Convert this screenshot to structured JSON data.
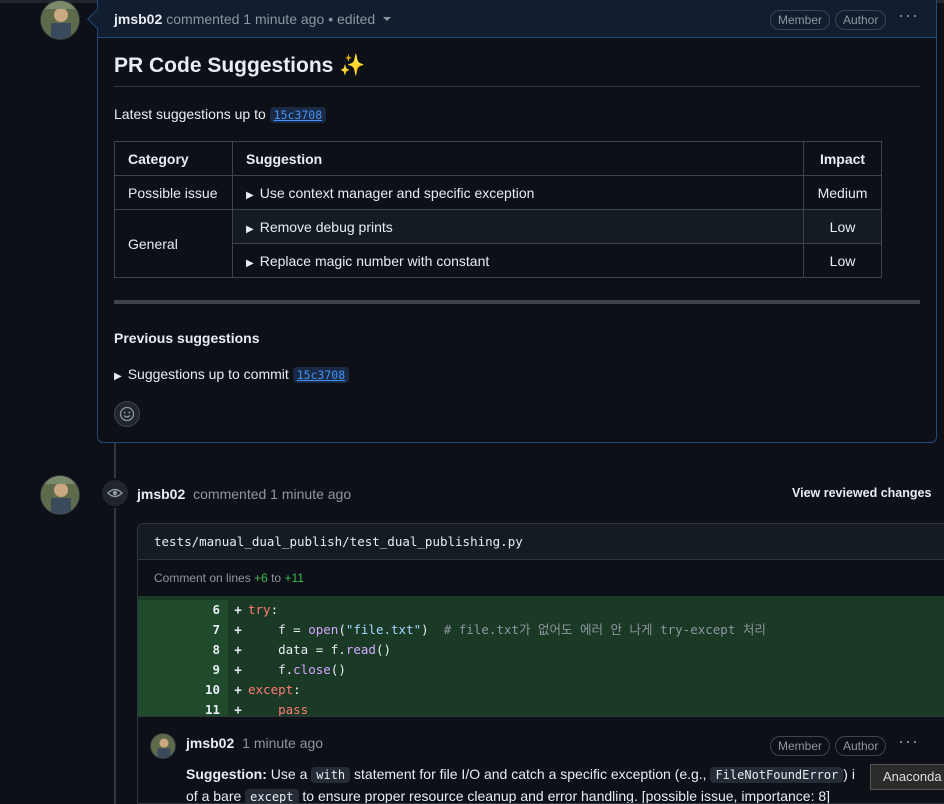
{
  "comment1": {
    "author": "jmsb02",
    "meta": "commented 1 minute ago",
    "edited": "• edited",
    "badges": [
      "Member",
      "Author"
    ],
    "title": "PR Code Suggestions",
    "title_emoji": "✨",
    "latest_prefix": "Latest suggestions up to",
    "latest_commit": "15c3708",
    "table": {
      "headers": [
        "Category",
        "Suggestion",
        "Impact"
      ],
      "rows": [
        {
          "category": "Possible issue",
          "suggestion": "Use context manager and specific exception",
          "impact": "Medium"
        },
        {
          "category": "General",
          "suggestion": "Remove debug prints",
          "impact": "Low"
        },
        {
          "category": "",
          "suggestion": "Replace magic number with constant",
          "impact": "Low"
        }
      ]
    },
    "previous_title": "Previous suggestions",
    "previous_item": "Suggestions up to commit",
    "previous_commit": "15c3708"
  },
  "comment2": {
    "author": "jmsb02",
    "meta": "commented 1 minute ago",
    "view_reviewed": "View reviewed changes",
    "file_path": "tests/manual_dual_publish/test_dual_publishing.py",
    "comment_lines_prefix": "Comment on lines",
    "line_from": "+6",
    "line_to_word": "to",
    "line_to": "+11",
    "diff_lines": [
      {
        "n": "6",
        "code_parts": [
          [
            "kw",
            "try"
          ],
          [
            "",
            ":"
          ]
        ]
      },
      {
        "n": "7",
        "code_parts": [
          [
            "",
            "    f = "
          ],
          [
            "fn",
            "open"
          ],
          [
            "",
            "("
          ],
          [
            "str",
            "\"file.txt\""
          ],
          [
            "",
            ")  "
          ],
          [
            "cm",
            "# file.txt가 없어도 에러 안 나게 try-except 처리"
          ]
        ]
      },
      {
        "n": "8",
        "code_parts": [
          [
            "",
            "    data = f."
          ],
          [
            "fn",
            "read"
          ],
          [
            "",
            "()"
          ]
        ]
      },
      {
        "n": "9",
        "code_parts": [
          [
            "",
            "    f."
          ],
          [
            "fn",
            "close"
          ],
          [
            "",
            "()"
          ]
        ]
      },
      {
        "n": "10",
        "code_parts": [
          [
            "kw",
            "except"
          ],
          [
            "",
            ":"
          ]
        ]
      },
      {
        "n": "11",
        "code_parts": [
          [
            "",
            "    "
          ],
          [
            "kw",
            "pass"
          ]
        ]
      }
    ],
    "reply": {
      "author": "jmsb02",
      "meta": "1 minute ago",
      "badges": [
        "Member",
        "Author"
      ],
      "suggestion_label": "Suggestion:",
      "t1": "Use a",
      "c1": "with",
      "t2": "statement for file I/O and catch a specific exception (e.g.,",
      "c2": "FileNotFoundError",
      "t3": ") i",
      "t4": "of a bare",
      "c3": "except",
      "t5": "to ensure proper resource cleanup and error handling. [possible issue, importance: 8]"
    }
  },
  "tooltip": "Anaconda"
}
